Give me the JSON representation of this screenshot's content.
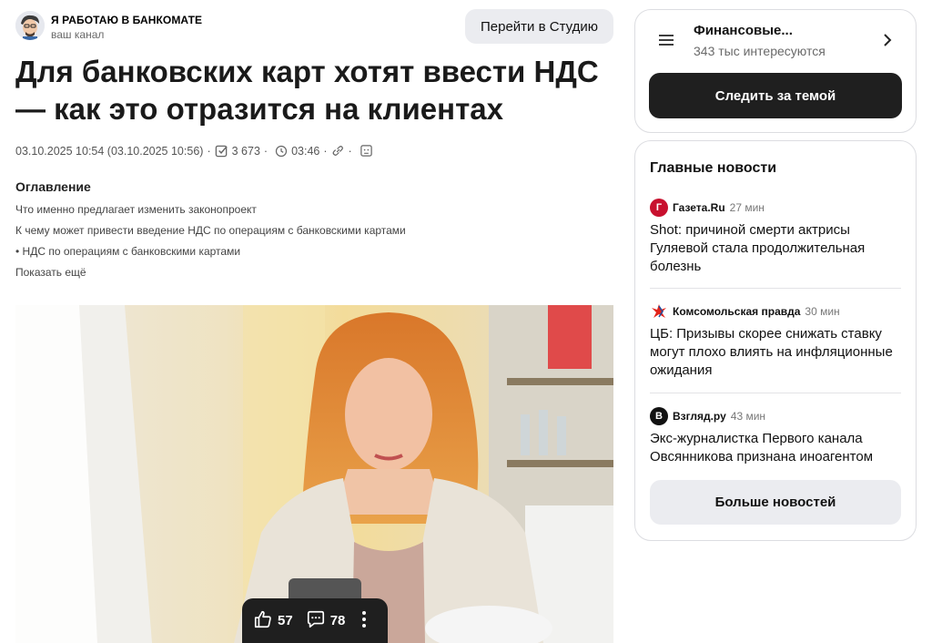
{
  "channel": {
    "name": "Я РАБОТАЮ В БАНКОМАТЕ",
    "subtitle": "ваш канал"
  },
  "studio_button": "Перейти в Студию",
  "article": {
    "title": "Для банковских карт хотят ввести НДС — как это отразится на клиентах",
    "meta": {
      "date": "03.10.2025 10:54 (03.10.2025 10:56)",
      "sep": "·",
      "reads": "3 673",
      "read_time": "03:46"
    },
    "toc": {
      "title": "Оглавление",
      "items": [
        "Что именно предлагает изменить законопроект",
        "К чему может привести введение НДС по операциям с банковскими картами",
        "• НДС по операциям с банковскими картами"
      ],
      "more": "Показать ещё"
    },
    "reactions": {
      "likes": "57",
      "comments": "78"
    }
  },
  "topic": {
    "name": "Финансовые...",
    "followers": "343 тыс интересуются",
    "follow_button": "Следить за темой"
  },
  "news": {
    "title": "Главные новости",
    "items": [
      {
        "source": "Газета.Ru",
        "time": "27 мин",
        "headline": "Shot: причиной смерти актрисы Гуляевой стала продолжительная болезнь",
        "logo_color": "#c8102e",
        "logo_letter": "Г"
      },
      {
        "source": "Комсомольская правда",
        "time": "30 мин",
        "headline": "ЦБ: Призывы скорее снижать ставку могут плохо влиять на инфляционные ожидания",
        "logo_color": "#e2231a",
        "logo_letter": ""
      },
      {
        "source": "Взгляд.ру",
        "time": "43 мин",
        "headline": "Экс-журналистка Первого канала Овсянникова признана иноагентом",
        "logo_color": "#111111",
        "logo_letter": "В"
      }
    ],
    "more_button": "Больше новостей"
  }
}
